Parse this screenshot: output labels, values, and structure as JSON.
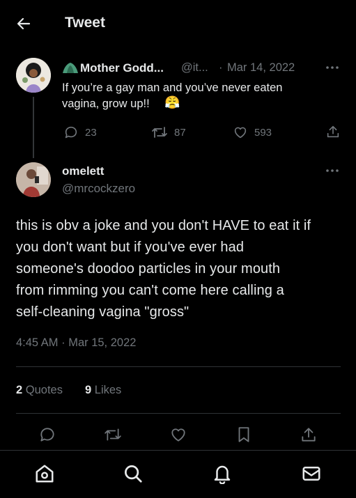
{
  "header": {
    "title": "Tweet"
  },
  "parent_tweet": {
    "display_name": "Mother Godd...",
    "handle": "@it...",
    "separator": "·",
    "date": "Mar 14, 2022",
    "text_line1": "If you’re a gay man and you’ve never eaten",
    "text_line2": "vagina, grow up!!",
    "emoji": "😤",
    "replies": "23",
    "retweets": "87",
    "likes": "593"
  },
  "main_tweet": {
    "display_name": "omelett",
    "handle": "@mrcockzero",
    "lines": [
      "this is obv a joke and you don't HAVE to eat it if",
      "you don't want but if you've ever had",
      "someone's doodoo particles in your mouth",
      "from rimming you can't come here calling a",
      "self-cleaning vagina \"gross\""
    ],
    "timestamp": "4:45 AM · Mar 15, 2022",
    "quotes_count": "2",
    "quotes_label": "Quotes",
    "likes_count": "9",
    "likes_label": "Likes"
  },
  "icons": {
    "back": "back-arrow-icon",
    "more": "more-icon",
    "reply": "reply-icon",
    "retweet": "retweet-icon",
    "like": "heart-icon",
    "share": "share-icon",
    "bookmark": "bookmark-icon",
    "home": "home-icon",
    "search": "search-icon",
    "notifications": "bell-icon",
    "messages": "mail-icon"
  },
  "colors": {
    "background": "#000000",
    "text": "#e7e9ea",
    "muted": "#71767b",
    "divider": "#2f3336"
  }
}
